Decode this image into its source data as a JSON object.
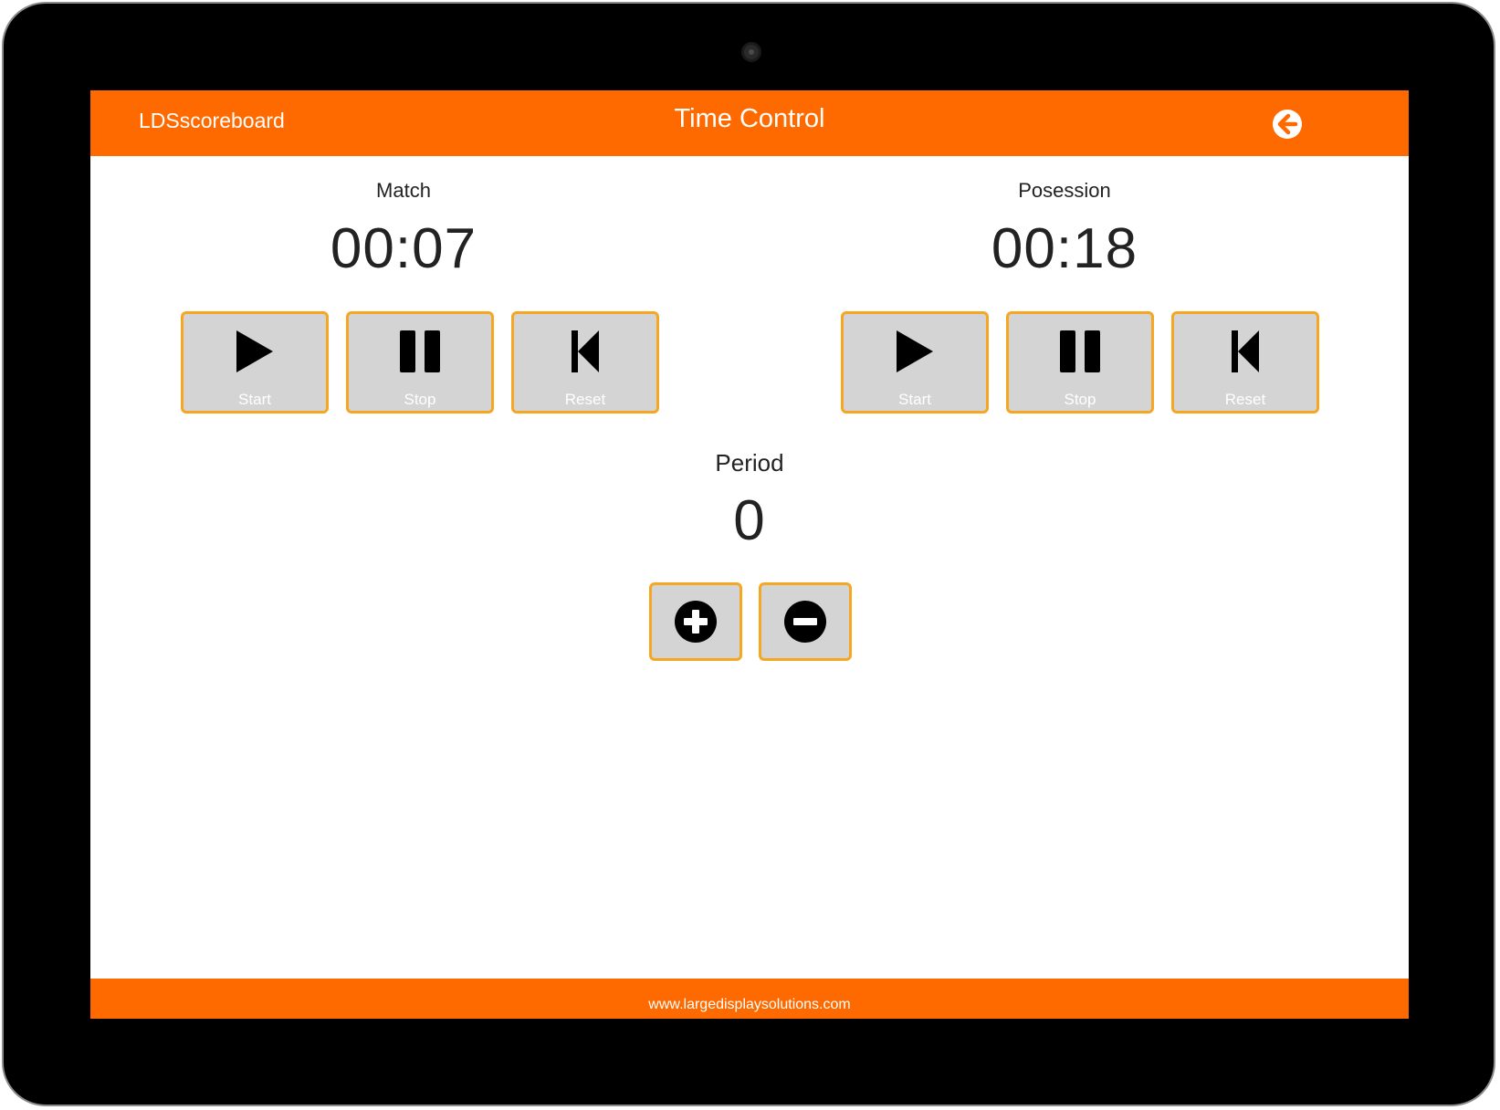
{
  "app": {
    "name": "LDSscoreboard",
    "title": "Time Control",
    "back_icon": "arrow-left-circle-icon"
  },
  "match": {
    "title": "Match",
    "time": "00:07",
    "buttons": {
      "start": {
        "label": "Start",
        "icon": "play-icon"
      },
      "stop": {
        "label": "Stop",
        "icon": "pause-icon"
      },
      "reset": {
        "label": "Reset",
        "icon": "skip-back-icon"
      }
    }
  },
  "possession": {
    "title": "Posession",
    "time": "00:18",
    "buttons": {
      "start": {
        "label": "Start",
        "icon": "play-icon"
      },
      "stop": {
        "label": "Stop",
        "icon": "pause-icon"
      },
      "reset": {
        "label": "Reset",
        "icon": "skip-back-icon"
      }
    }
  },
  "period": {
    "title": "Period",
    "value": "0",
    "increment_icon": "plus-circle-icon",
    "decrement_icon": "minus-circle-icon"
  },
  "footer": {
    "link": "www.largedisplaysolutions.com"
  },
  "colors": {
    "accent": "#ff6a00",
    "button_bg": "#d4d4d4",
    "button_border": "#f5a623",
    "text": "#222222"
  }
}
